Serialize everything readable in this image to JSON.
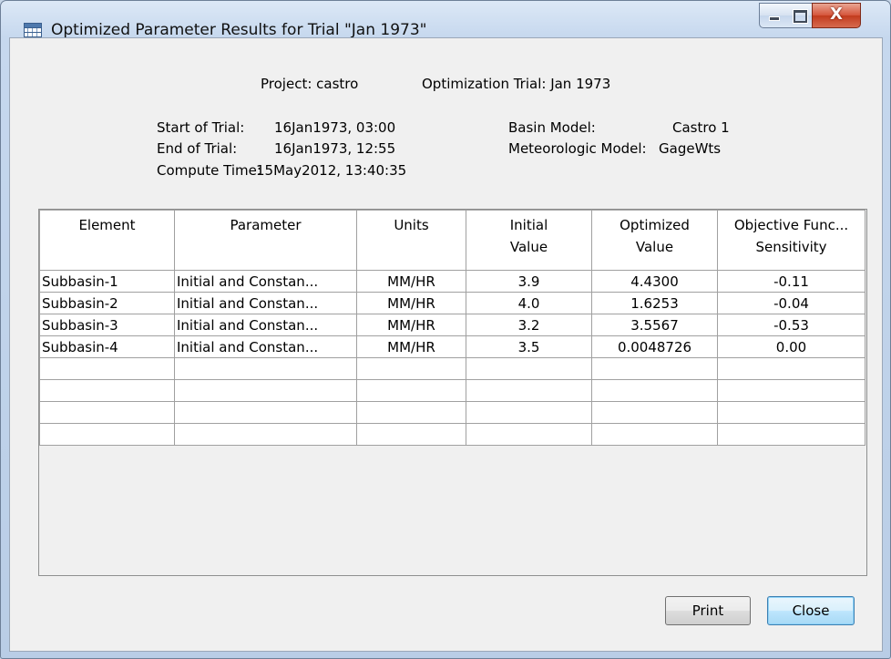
{
  "window": {
    "title": "Optimized Parameter Results for Trial \"Jan 1973\"",
    "close_glyph": "X"
  },
  "header": {
    "project_label": "Project: castro",
    "trial_label": "Optimization Trial: Jan 1973",
    "start_label": "Start of Trial:",
    "start_value": "16Jan1973, 03:00",
    "end_label": "End of Trial:",
    "end_value": "16Jan1973, 12:55",
    "compute_label": "Compute Time:",
    "compute_value": "15May2012, 13:40:35",
    "basin_label": "Basin Model:",
    "basin_value": "Castro 1",
    "met_label": "Meteorologic Model:",
    "met_value": "GageWts"
  },
  "table": {
    "columns": [
      {
        "line1": "Element",
        "line2": ""
      },
      {
        "line1": "Parameter",
        "line2": ""
      },
      {
        "line1": "Units",
        "line2": ""
      },
      {
        "line1": "Initial",
        "line2": "Value"
      },
      {
        "line1": "Optimized",
        "line2": "Value"
      },
      {
        "line1": "Objective Func...",
        "line2": "Sensitivity"
      }
    ],
    "rows": [
      [
        "Subbasin-1",
        "Initial and Constan...",
        "MM/HR",
        "3.9",
        "4.4300",
        "-0.11"
      ],
      [
        "Subbasin-2",
        "Initial and Constan...",
        "MM/HR",
        "4.0",
        "1.6253",
        "-0.04"
      ],
      [
        "Subbasin-3",
        "Initial and Constan...",
        "MM/HR",
        "3.2",
        "3.5567",
        "-0.53"
      ],
      [
        "Subbasin-4",
        "Initial and Constan...",
        "MM/HR",
        "3.5",
        "0.0048726",
        "0.00"
      ]
    ]
  },
  "buttons": {
    "print": "Print",
    "close": "Close"
  }
}
